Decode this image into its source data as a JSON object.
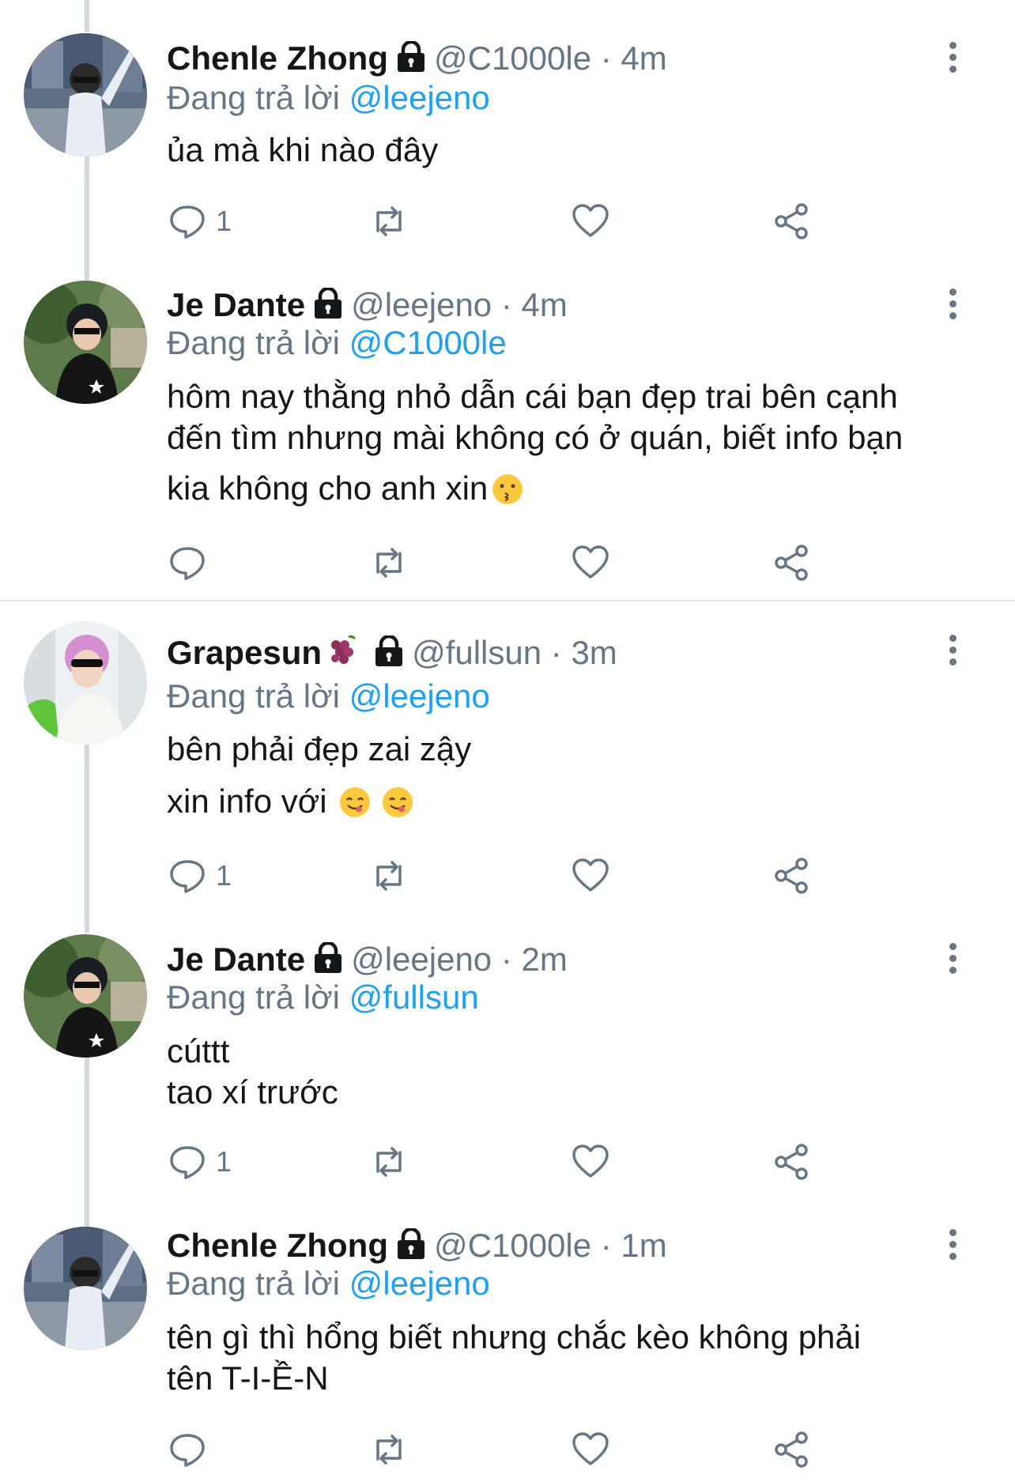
{
  "tweets": [
    {
      "name": "Chenle Zhong",
      "handle": "@C1000le",
      "time": "4m",
      "replying_prefix": "Đang trả lời ",
      "replying_to": "@leejeno",
      "lines": [
        "ủa mà khi nào đây"
      ],
      "reply_count": "1",
      "avatar_icon": "avatar-chenle"
    },
    {
      "name": "Je Dante",
      "handle": "@leejeno",
      "time": "4m",
      "replying_prefix": "Đang trả lời ",
      "replying_to": "@C1000le",
      "lines": [
        "hôm nay thằng nhỏ dẫn cái bạn đẹp trai bên cạnh",
        "đến tìm nhưng mài không có ở quán, biết info bạn",
        "kia không cho anh xin"
      ],
      "reply_count": "",
      "avatar_icon": "avatar-jedante"
    },
    {
      "name": "Grapesun",
      "handle": "@fullsun",
      "time": "3m",
      "replying_prefix": "Đang trả lời ",
      "replying_to": "@leejeno",
      "lines": [
        "bên phải đẹp zai zậy",
        "xin info với"
      ],
      "reply_count": "1",
      "avatar_icon": "avatar-grapesun"
    },
    {
      "name": "Je Dante",
      "handle": "@leejeno",
      "time": "2m",
      "replying_prefix": "Đang trả lời ",
      "replying_to": "@fullsun",
      "lines": [
        "cúttt",
        "tao xí trước"
      ],
      "reply_count": "1",
      "avatar_icon": "avatar-jedante"
    },
    {
      "name": "Chenle Zhong",
      "handle": "@C1000le",
      "time": "1m",
      "replying_prefix": "Đang trả lời ",
      "replying_to": "@leejeno",
      "lines": [
        "tên gì thì hổng biết nhưng chắc kèo không phải",
        "tên T-I-Ề-N"
      ],
      "reply_count": "",
      "avatar_icon": "avatar-chenle"
    }
  ],
  "separator": " · ",
  "icons": {
    "lock": "lock-icon",
    "reply": "reply-icon",
    "retweet": "retweet-icon",
    "like": "heart-icon",
    "share": "share-icon",
    "more": "more-vertical-icon"
  },
  "colors": {
    "link": "#1da1f2",
    "muted": "#657786",
    "text": "#14171a",
    "thread_line": "#d3d8dd"
  }
}
